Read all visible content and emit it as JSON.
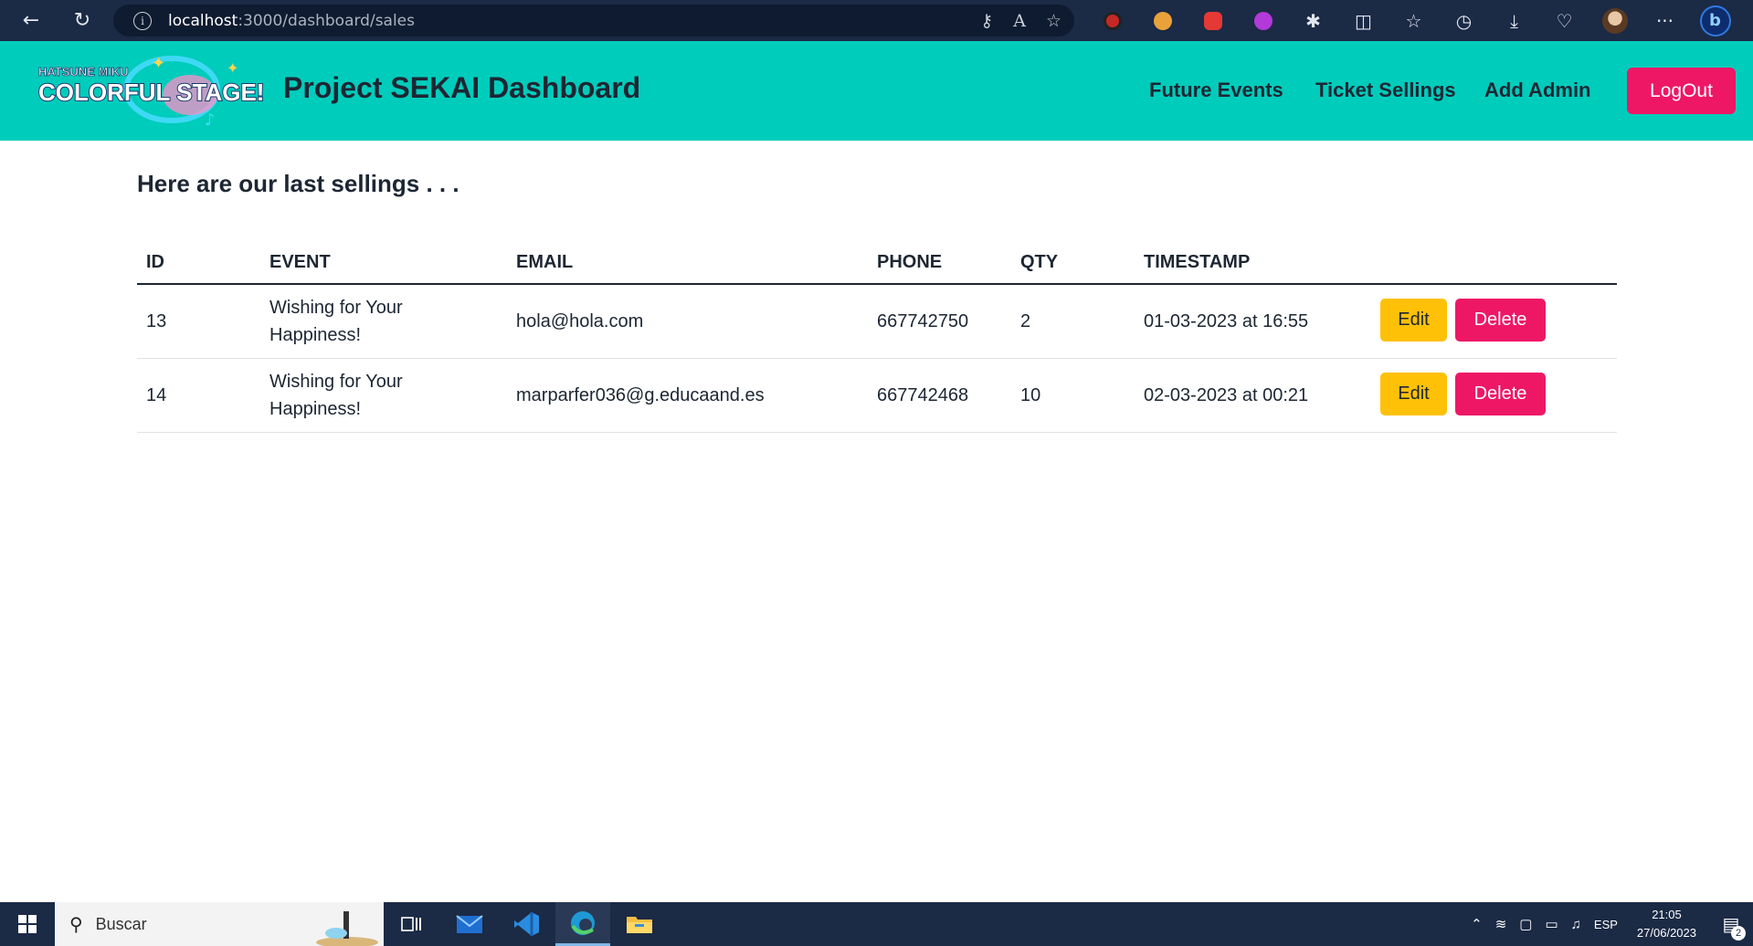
{
  "browser": {
    "url_host": "localhost",
    "url_path": ":3000/dashboard/sales",
    "back_glyph": "←",
    "reload_glyph": "↻",
    "more_glyph": "···",
    "bing_label": "b"
  },
  "header": {
    "logo_line1": "HATSUNE MIKU",
    "logo_line2": "COLORFUL STAGE!",
    "title": "Project SEKAI Dashboard",
    "nav": [
      "Future Events",
      "Ticket Sellings",
      "Add Admin"
    ],
    "logout": "LogOut"
  },
  "main": {
    "heading": "Here are our last sellings . . .",
    "columns": [
      "ID",
      "EVENT",
      "EMAIL",
      "PHONE",
      "QTY",
      "TIMESTAMP"
    ],
    "rows": [
      {
        "id": "13",
        "event_line1": "Wishing for Your",
        "event_line2": "Happiness!",
        "email": "hola@hola.com",
        "phone": "667742750",
        "qty": "2",
        "timestamp": "01-03-2023 at 16:55"
      },
      {
        "id": "14",
        "event_line1": "Wishing for Your",
        "event_line2": "Happiness!",
        "email": "marparfer036@g.educaand.es",
        "phone": "667742468",
        "qty": "10",
        "timestamp": "02-03-2023 at 00:21"
      }
    ],
    "edit_label": "Edit",
    "delete_label": "Delete"
  },
  "taskbar": {
    "search_placeholder": "Buscar",
    "lang": "ESP",
    "time": "21:05",
    "date": "27/06/2023",
    "notifications": "2"
  },
  "colors": {
    "header_bg": "#00ccbb",
    "primary": "#ee1766",
    "edit": "#fec107",
    "text": "#1d2633"
  }
}
